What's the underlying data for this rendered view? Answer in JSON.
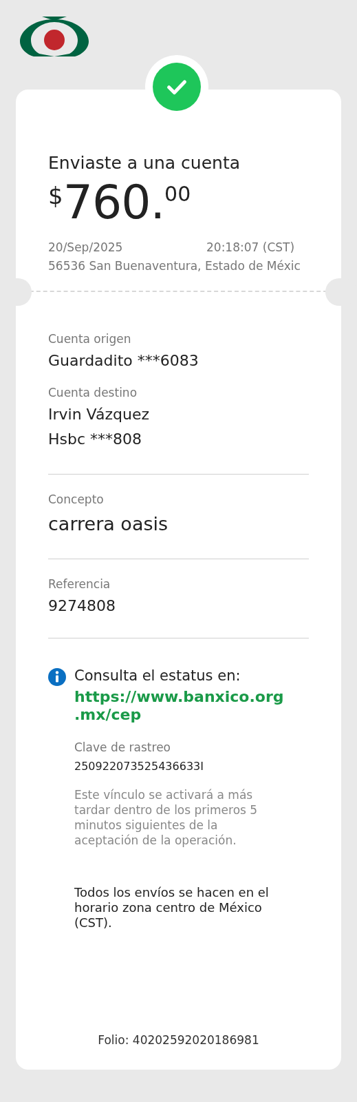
{
  "receipt": {
    "title": "Enviaste a una cuenta",
    "amount": {
      "currency": "$",
      "integer": "760.",
      "cents": "00"
    },
    "date": "20/Sep/2025",
    "time": "20:18:07 (CST)",
    "location": "56536 San Buenaventura, Estado de Méxic"
  },
  "sections": [
    {
      "fields": [
        {
          "label": "Cuenta origen",
          "lines": [
            "Guardadito ***6083"
          ],
          "large": false
        },
        {
          "label": "Cuenta destino",
          "lines": [
            "Irvin Vázquez",
            "Hsbc ***808"
          ],
          "large": false
        }
      ]
    },
    {
      "fields": [
        {
          "label": "Concepto",
          "lines": [
            "carrera oasis"
          ],
          "large": true
        }
      ]
    },
    {
      "fields": [
        {
          "label": "Referencia",
          "lines": [
            "9274808"
          ],
          "large": false
        }
      ]
    }
  ],
  "status_info": {
    "heading": "Consulta el estatus en:",
    "link": "https://www.banxico.org .mx/cep",
    "tracking_label": "Clave de rastreo",
    "tracking_key": "250922073525436633I",
    "note": "Este vínculo se activará a más tardar dentro de los primeros 5 minutos siguientes de la aceptación de la operación.",
    "schedule": "Todos los envíos se hacen en el horario zona centro de México (CST)."
  },
  "folio": "Folio: 40202592020186981"
}
